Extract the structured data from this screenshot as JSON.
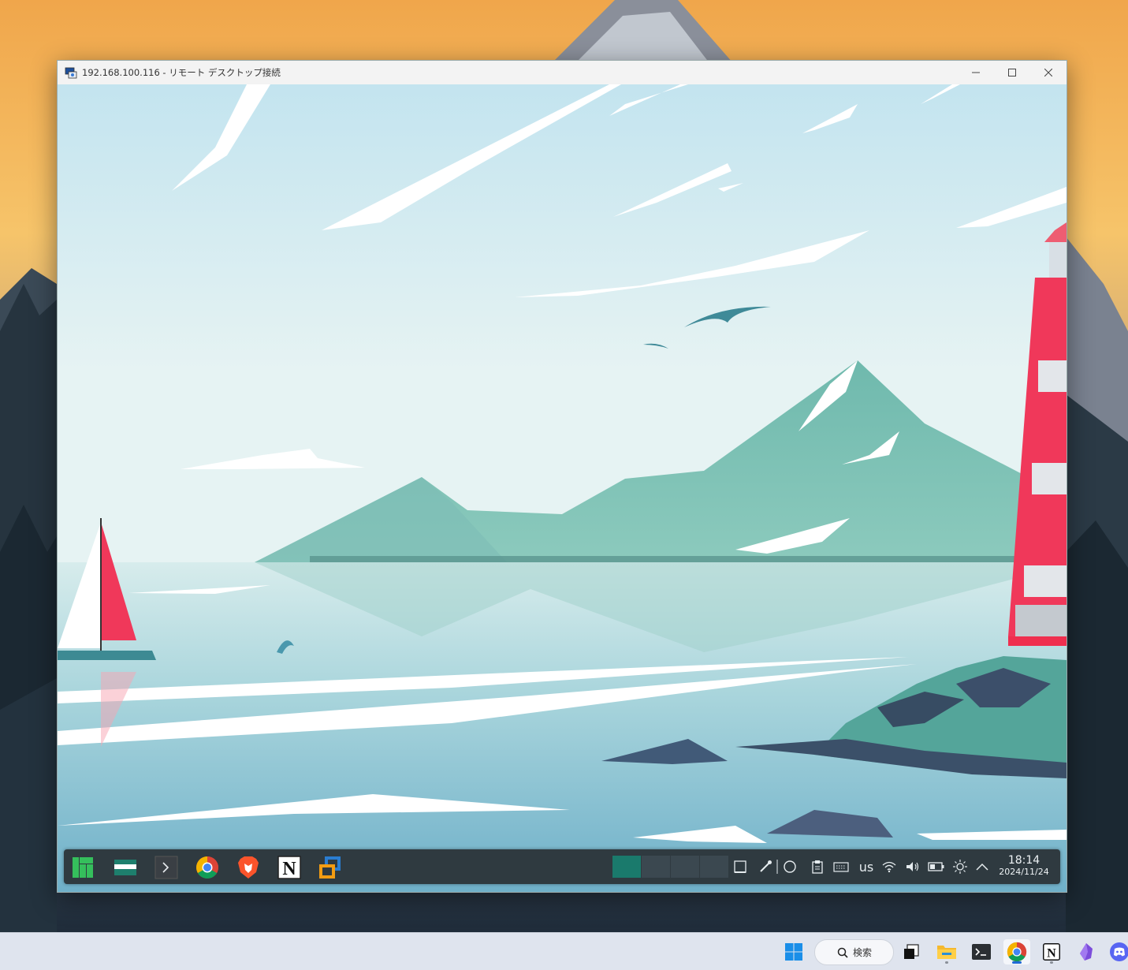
{
  "rdp_window": {
    "title": "192.168.100.116 - リモート デスクトップ接続",
    "controls": [
      "minimize",
      "maximize",
      "close"
    ]
  },
  "kde_panel": {
    "launchers": [
      {
        "name": "Application Menu",
        "icon": "manjaro-icon"
      },
      {
        "name": "File Manager",
        "icon": "folder-icon"
      },
      {
        "name": "Terminal",
        "icon": "terminal-icon"
      },
      {
        "name": "Google Chrome",
        "icon": "chrome-icon"
      },
      {
        "name": "Brave",
        "icon": "brave-icon"
      },
      {
        "name": "Notion",
        "icon": "notion-icon",
        "glyph": "N"
      },
      {
        "name": "VirtualBox",
        "icon": "virtualbox-icon"
      }
    ],
    "pager": {
      "desktops": 4,
      "active": 1
    },
    "tray": {
      "keyboard_layout": "us",
      "icons": [
        "show-desktop-icon",
        "color-picker-icon",
        "circle-icon",
        "clipboard-icon",
        "keyboard-icon",
        "wifi-icon",
        "volume-icon",
        "battery-icon",
        "brightness-icon",
        "expand-arrow-icon"
      ]
    },
    "clock": {
      "time": "18:14",
      "date": "2024/11/24"
    }
  },
  "windows_taskbar": {
    "search_label": "検索",
    "items": [
      {
        "name": "Start",
        "icon": "windows-start-icon"
      },
      {
        "name": "Task View",
        "icon": "task-view-icon"
      },
      {
        "name": "File Explorer",
        "icon": "file-explorer-icon"
      },
      {
        "name": "Terminal",
        "icon": "terminal-icon"
      },
      {
        "name": "Google Chrome",
        "icon": "chrome-icon",
        "active": true
      },
      {
        "name": "Notion",
        "icon": "notion-icon",
        "glyph": "N"
      },
      {
        "name": "Obsidian",
        "icon": "obsidian-icon"
      },
      {
        "name": "Discord",
        "icon": "discord-icon"
      }
    ]
  },
  "colors": {
    "accent": "#1a7a6c",
    "panel_bg": "#2f3a40",
    "taskbar_bg": "#dfe4ee",
    "active_indicator": "#1f6ad6"
  }
}
